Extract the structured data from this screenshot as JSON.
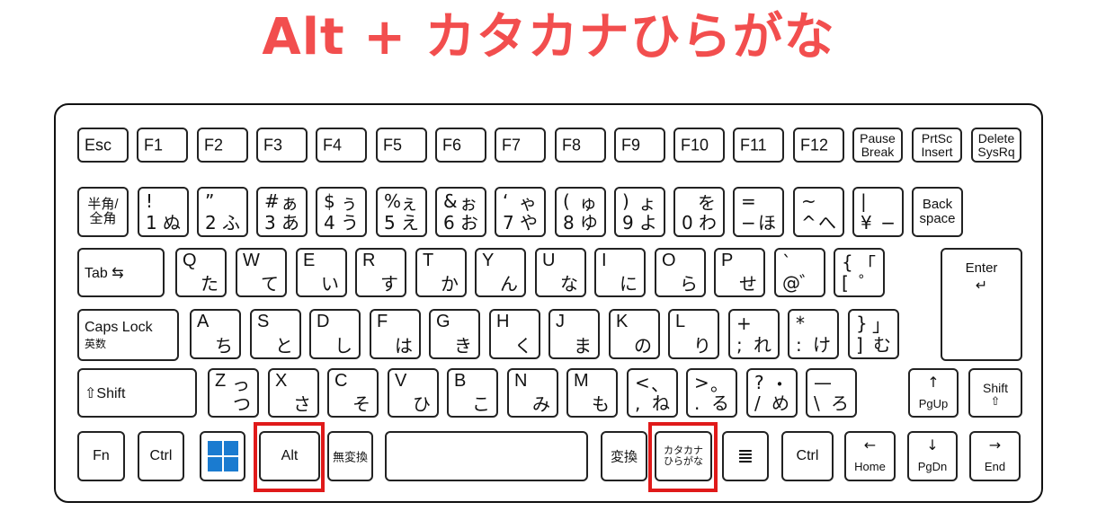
{
  "title": "Alt + カタカナひらがな",
  "colors": {
    "title": "#f24e4e",
    "highlight": "#e01a1a",
    "windows_logo": "#1a7bd0",
    "key_border": "#222222"
  },
  "highlighted_keys": [
    "Alt",
    "カタカナひらがな"
  ],
  "rows": {
    "function": [
      "Esc",
      "F1",
      "F2",
      "F3",
      "F4",
      "F5",
      "F6",
      "F7",
      "F8",
      "F9",
      "F10",
      "F11",
      "F12"
    ],
    "function_special": [
      {
        "top": "Pause",
        "bottom": "Break"
      },
      {
        "top": "PrtSc",
        "bottom": "Insert"
      },
      {
        "top": "Delete",
        "bottom": "SysRq"
      }
    ],
    "number": [
      {
        "top": "半角/",
        "bottom": "全角",
        "type": "twoline"
      },
      {
        "tl": "!",
        "tr": "",
        "bl": "1",
        "br": "ぬ"
      },
      {
        "tl": "”",
        "tr": "",
        "bl": "2",
        "br": "ふ"
      },
      {
        "tl": "#",
        "tr": "ぁ",
        "bl": "3",
        "br": "あ"
      },
      {
        "tl": "$",
        "tr": "ぅ",
        "bl": "4",
        "br": "う"
      },
      {
        "tl": "%",
        "tr": "ぇ",
        "bl": "5",
        "br": "え"
      },
      {
        "tl": "&",
        "tr": "ぉ",
        "bl": "6",
        "br": "お"
      },
      {
        "tl": "‘",
        "tr": "ゃ",
        "bl": "7",
        "br": "や"
      },
      {
        "tl": "(",
        "tr": "ゅ",
        "bl": "8",
        "br": "ゆ"
      },
      {
        "tl": ")",
        "tr": "ょ",
        "bl": "9",
        "br": "よ"
      },
      {
        "tl": "",
        "tr": "を",
        "bl": "0",
        "br": "わ"
      },
      {
        "tl": "=",
        "tr": "",
        "bl": "−",
        "br": "ほ"
      },
      {
        "tl": "~",
        "tr": "",
        "bl": "^",
        "br": "へ"
      },
      {
        "tl": "|",
        "tr": "",
        "bl": "¥",
        "br": "−"
      },
      {
        "top": "Back",
        "bottom": "space",
        "type": "twoline"
      }
    ],
    "qwerty": {
      "tab_label": "Tab",
      "tab_arrows": "⇆",
      "keys": [
        {
          "tl": "Q",
          "br": "た"
        },
        {
          "tl": "W",
          "br": "て"
        },
        {
          "tl": "E",
          "br": "い"
        },
        {
          "tl": "R",
          "br": "す"
        },
        {
          "tl": "T",
          "br": "か"
        },
        {
          "tl": "Y",
          "br": "ん"
        },
        {
          "tl": "U",
          "br": "な"
        },
        {
          "tl": "I",
          "br": "に"
        },
        {
          "tl": "O",
          "br": "ら"
        },
        {
          "tl": "P",
          "br": "せ"
        },
        {
          "tl": "`",
          "bl": "@",
          "br": "゛",
          "sym": true
        },
        {
          "tl": "{",
          "tr": "「",
          "bl": "[",
          "br": "゜",
          "sym": true
        }
      ],
      "enter_label": "Enter",
      "enter_arrow": "↵"
    },
    "home": {
      "caps_top": "Caps Lock",
      "caps_bottom": "英数",
      "keys": [
        {
          "tl": "A",
          "br": "ち"
        },
        {
          "tl": "S",
          "br": "と"
        },
        {
          "tl": "D",
          "br": "し"
        },
        {
          "tl": "F",
          "br": "は"
        },
        {
          "tl": "G",
          "br": "き"
        },
        {
          "tl": "H",
          "br": "く"
        },
        {
          "tl": "J",
          "br": "ま"
        },
        {
          "tl": "K",
          "br": "の"
        },
        {
          "tl": "L",
          "br": "り"
        },
        {
          "tl": "+",
          "bl": ";",
          "br": "れ",
          "sym": true
        },
        {
          "tl": "*",
          "bl": ":",
          "br": "け",
          "sym": true
        },
        {
          "tl": "}",
          "tr": "」",
          "bl": "]",
          "br": "む",
          "sym": true
        }
      ]
    },
    "shift_row": {
      "left_shift": "⇧Shift",
      "keys": [
        {
          "tl": "Z",
          "tr": "っ",
          "br": "つ"
        },
        {
          "tl": "X",
          "br": "さ"
        },
        {
          "tl": "C",
          "br": "そ"
        },
        {
          "tl": "V",
          "br": "ひ"
        },
        {
          "tl": "B",
          "br": "こ"
        },
        {
          "tl": "N",
          "br": "み"
        },
        {
          "tl": "M",
          "br": "も"
        },
        {
          "tl": "<",
          "tr": "、",
          "bl": ",",
          "br": "ね",
          "sym": true
        },
        {
          "tl": ">",
          "tr": "。",
          "bl": ".",
          "br": "る",
          "sym": true
        },
        {
          "tl": "?",
          "tr": "・",
          "bl": "/",
          "br": "め",
          "sym": true
        },
        {
          "tl": "—",
          "bl": "\\",
          "br": "ろ",
          "sym": true
        }
      ],
      "pgup_arrow": "↑",
      "pgup_label": "PgUp",
      "right_shift_top": "Shift",
      "right_shift_bottom": "⇧"
    },
    "bottom": {
      "fn": "Fn",
      "ctrl_left": "Ctrl",
      "windows_icon": "windows-logo",
      "alt": "Alt",
      "muhenkan": "無変換",
      "space": "",
      "henkan": "変換",
      "kana_top": "カタカナ",
      "kana_bottom": "ひらがな",
      "menu_icon": "≣",
      "ctrl_right": "Ctrl",
      "home_arrow": "←",
      "home_label": "Home",
      "pgdn_arrow": "↓",
      "pgdn_label": "PgDn",
      "end_arrow": "→",
      "end_label": "End"
    }
  }
}
